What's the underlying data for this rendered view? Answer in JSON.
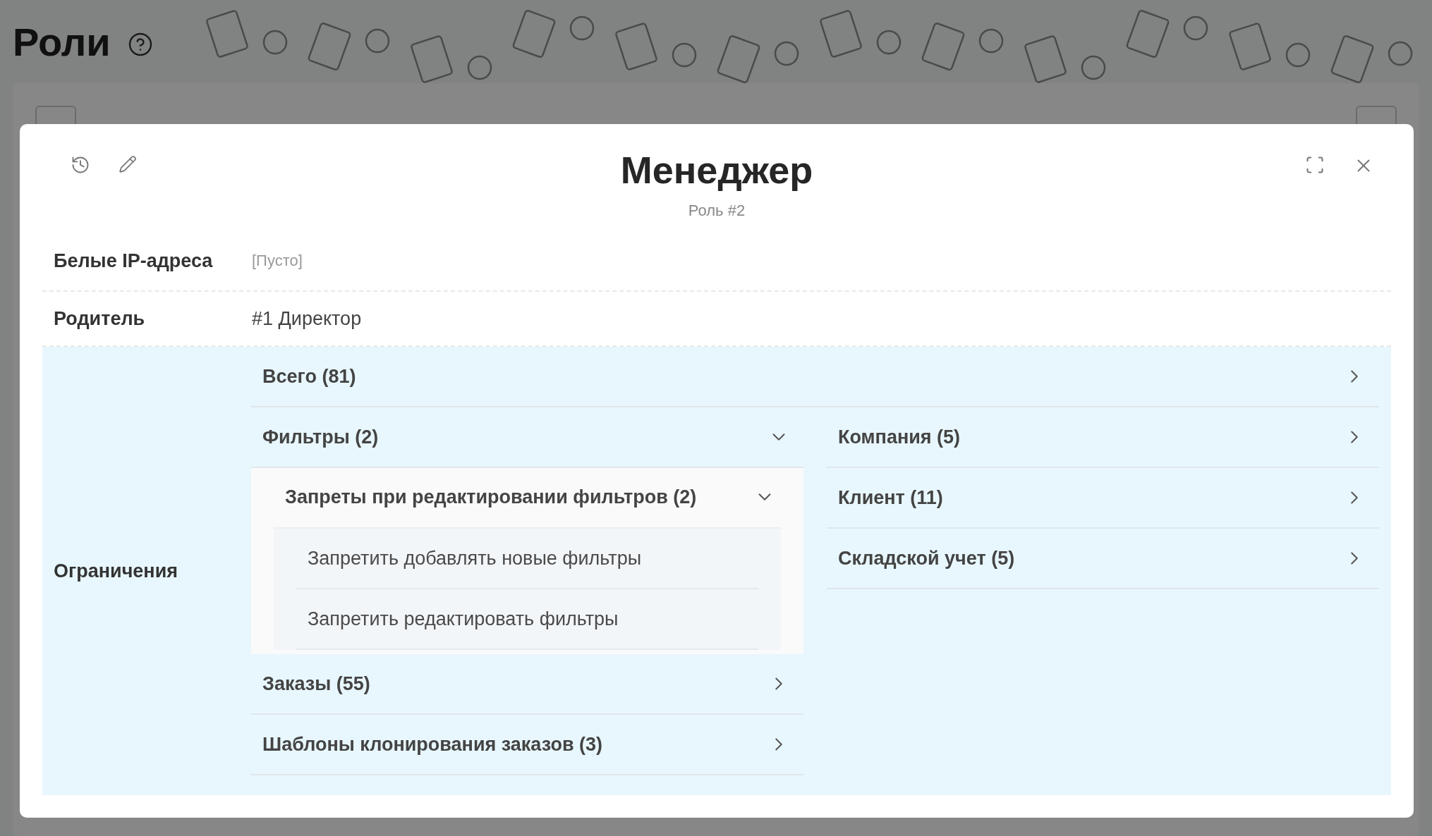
{
  "page": {
    "title": "Роли"
  },
  "modal": {
    "title": "Менеджер",
    "subtitle": "Роль #2",
    "fields": [
      {
        "label": "Белые IP-адреса",
        "value": "[Пусто]",
        "empty": true
      },
      {
        "label": "Родитель",
        "value": "#1 Директор",
        "empty": false
      }
    ],
    "restrictions": {
      "label": "Ограничения",
      "total": {
        "label": "Всего  (81)",
        "expanded": false
      },
      "left": [
        {
          "label": "Фильтры (2)",
          "expanded": true,
          "children": [
            {
              "label": "Запреты при редактировании фильтров (2)",
              "expanded": true,
              "children": [
                {
                  "label": "Запретить добавлять новые фильтры"
                },
                {
                  "label": "Запретить редактировать фильтры"
                }
              ]
            }
          ]
        },
        {
          "label": "Заказы (55)",
          "expanded": false
        },
        {
          "label": "Шаблоны клонирования заказов (3)",
          "expanded": false
        }
      ],
      "right": [
        {
          "label": "Компания (5)",
          "expanded": false
        },
        {
          "label": "Клиент (11)",
          "expanded": false
        },
        {
          "label": "Складской учет (5)",
          "expanded": false
        }
      ]
    }
  }
}
